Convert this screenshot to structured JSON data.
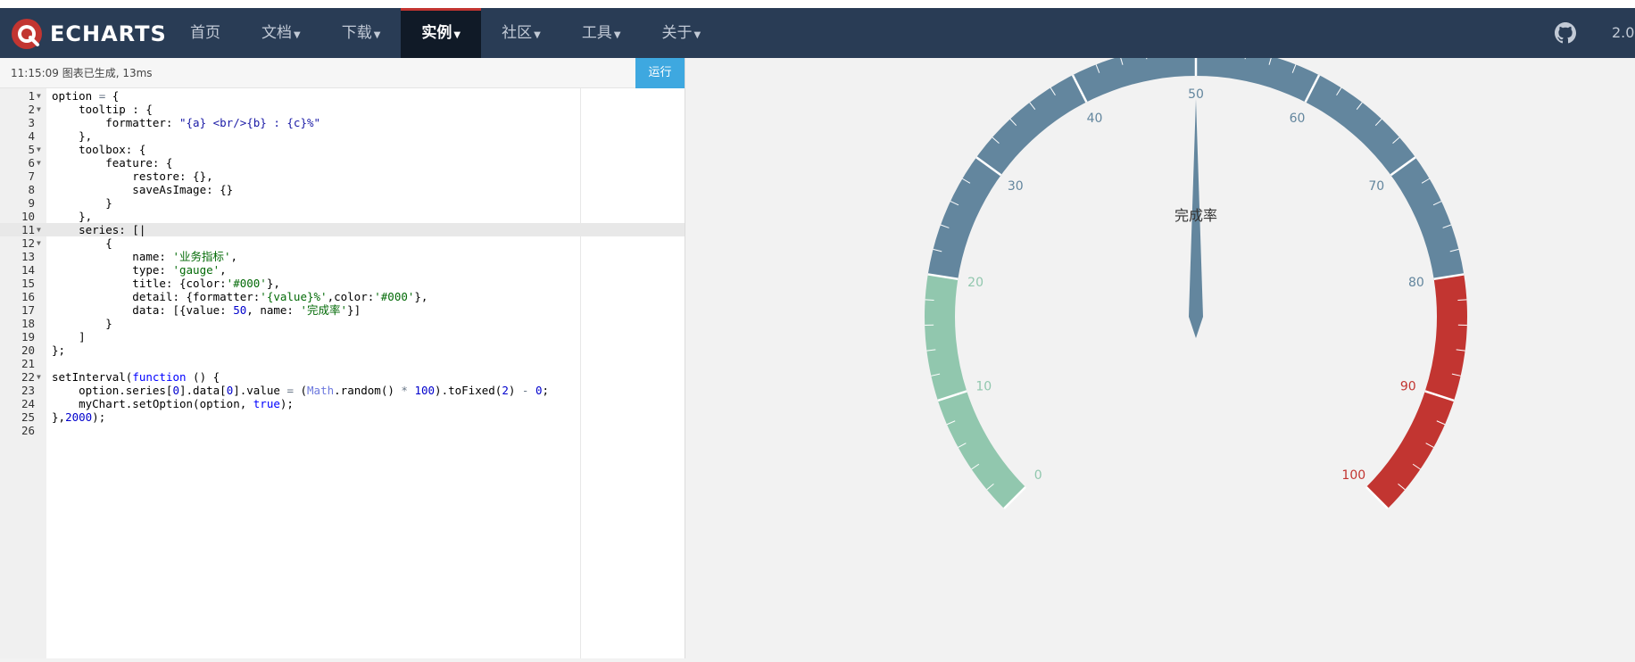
{
  "nav": {
    "logo_text": "ECHARTS",
    "items": [
      {
        "label": "首页",
        "dropdown": false,
        "active": false
      },
      {
        "label": "文档",
        "dropdown": true,
        "active": false
      },
      {
        "label": "下载",
        "dropdown": true,
        "active": false
      },
      {
        "label": "实例",
        "dropdown": true,
        "active": true
      },
      {
        "label": "社区",
        "dropdown": true,
        "active": false
      },
      {
        "label": "工具",
        "dropdown": true,
        "active": false
      },
      {
        "label": "关于",
        "dropdown": true,
        "active": false
      }
    ],
    "github_icon": "github-icon",
    "version": "2.0"
  },
  "status": {
    "text": "11:15:09   图表已生成, 13ms",
    "run_label": "运行"
  },
  "editor": {
    "active_line": 11,
    "lines": [
      {
        "n": "1",
        "fold": true,
        "code": "option = {"
      },
      {
        "n": "2",
        "fold": true,
        "code": "    tooltip : {"
      },
      {
        "n": "3",
        "fold": false,
        "code": "        formatter: \"{a} <br/>{b} : {c}%\""
      },
      {
        "n": "4",
        "fold": false,
        "code": "    },"
      },
      {
        "n": "5",
        "fold": true,
        "code": "    toolbox: {"
      },
      {
        "n": "6",
        "fold": true,
        "code": "        feature: {"
      },
      {
        "n": "7",
        "fold": false,
        "code": "            restore: {},"
      },
      {
        "n": "8",
        "fold": false,
        "code": "            saveAsImage: {}"
      },
      {
        "n": "9",
        "fold": false,
        "code": "        }"
      },
      {
        "n": "10",
        "fold": false,
        "code": "    },"
      },
      {
        "n": "11",
        "fold": true,
        "code": "    series: [|"
      },
      {
        "n": "12",
        "fold": true,
        "code": "        {"
      },
      {
        "n": "13",
        "fold": false,
        "code": "            name: '业务指标',"
      },
      {
        "n": "14",
        "fold": false,
        "code": "            type: 'gauge',"
      },
      {
        "n": "15",
        "fold": false,
        "code": "            title: {color:'#000'},"
      },
      {
        "n": "16",
        "fold": false,
        "code": "            detail: {formatter:'{value}%',color:'#000'},"
      },
      {
        "n": "17",
        "fold": false,
        "code": "            data: [{value: 50, name: '完成率'}]"
      },
      {
        "n": "18",
        "fold": false,
        "code": "        }"
      },
      {
        "n": "19",
        "fold": false,
        "code": "    ]"
      },
      {
        "n": "20",
        "fold": false,
        "code": "};"
      },
      {
        "n": "21",
        "fold": false,
        "code": ""
      },
      {
        "n": "22",
        "fold": true,
        "code": "setInterval(function () {"
      },
      {
        "n": "23",
        "fold": false,
        "code": "    option.series[0].data[0].value = (Math.random() * 100).toFixed(2) - 0;"
      },
      {
        "n": "24",
        "fold": false,
        "code": "    myChart.setOption(option, true);"
      },
      {
        "n": "25",
        "fold": false,
        "code": "},2000);"
      },
      {
        "n": "26",
        "fold": false,
        "code": ""
      }
    ]
  },
  "chart_data": {
    "type": "gauge",
    "min": 0,
    "max": 100,
    "value": 50,
    "title": "完成率",
    "tick_labels": [
      "0",
      "10",
      "20",
      "30",
      "40",
      "50",
      "60",
      "70",
      "80",
      "90",
      "100"
    ],
    "color_bands": [
      {
        "to": 0.2,
        "color": "#91c7ae"
      },
      {
        "to": 0.8,
        "color": "#63869e"
      },
      {
        "to": 1.0,
        "color": "#c23531"
      }
    ]
  }
}
